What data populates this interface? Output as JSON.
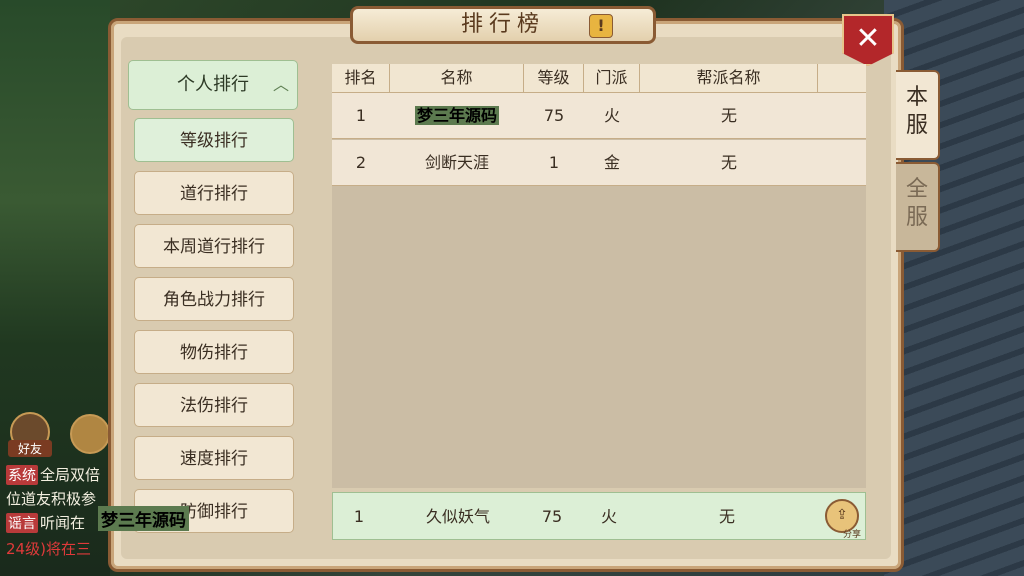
{
  "title": "排行榜",
  "info_label": "!",
  "close_label": "✕",
  "menu": {
    "header": "个人排行",
    "items": [
      {
        "label": "等级排行"
      },
      {
        "label": "道行排行"
      },
      {
        "label": "本周道行排行"
      },
      {
        "label": "角色战力排行"
      },
      {
        "label": "物伤排行"
      },
      {
        "label": "法伤排行"
      },
      {
        "label": "速度排行"
      },
      {
        "label": "防御排行"
      }
    ]
  },
  "table": {
    "headers": [
      "排名",
      "名称",
      "等级",
      "门派",
      "帮派名称"
    ],
    "rows": [
      {
        "rank": "1",
        "name": "梦三年源码",
        "level": "75",
        "school": "火",
        "guild": "无"
      },
      {
        "rank": "2",
        "name": "剑断天涯",
        "level": "1",
        "school": "金",
        "guild": "无"
      }
    ]
  },
  "self_row": {
    "rank": "1",
    "name": "久似妖气",
    "level": "75",
    "school": "火",
    "guild": "无",
    "share_label": "分享"
  },
  "tabs": {
    "server": "本服",
    "all": "全服"
  },
  "chat": {
    "friend_label": "好友",
    "line1_tag": "系统",
    "line1_text": "全局双倍",
    "line2_text": "位道友积极参",
    "line3_tag": "谣言",
    "line3_text": "听闻在",
    "line4_text": "24级)将在",
    "line4_tail": "三"
  },
  "watermark": "梦三年源码"
}
